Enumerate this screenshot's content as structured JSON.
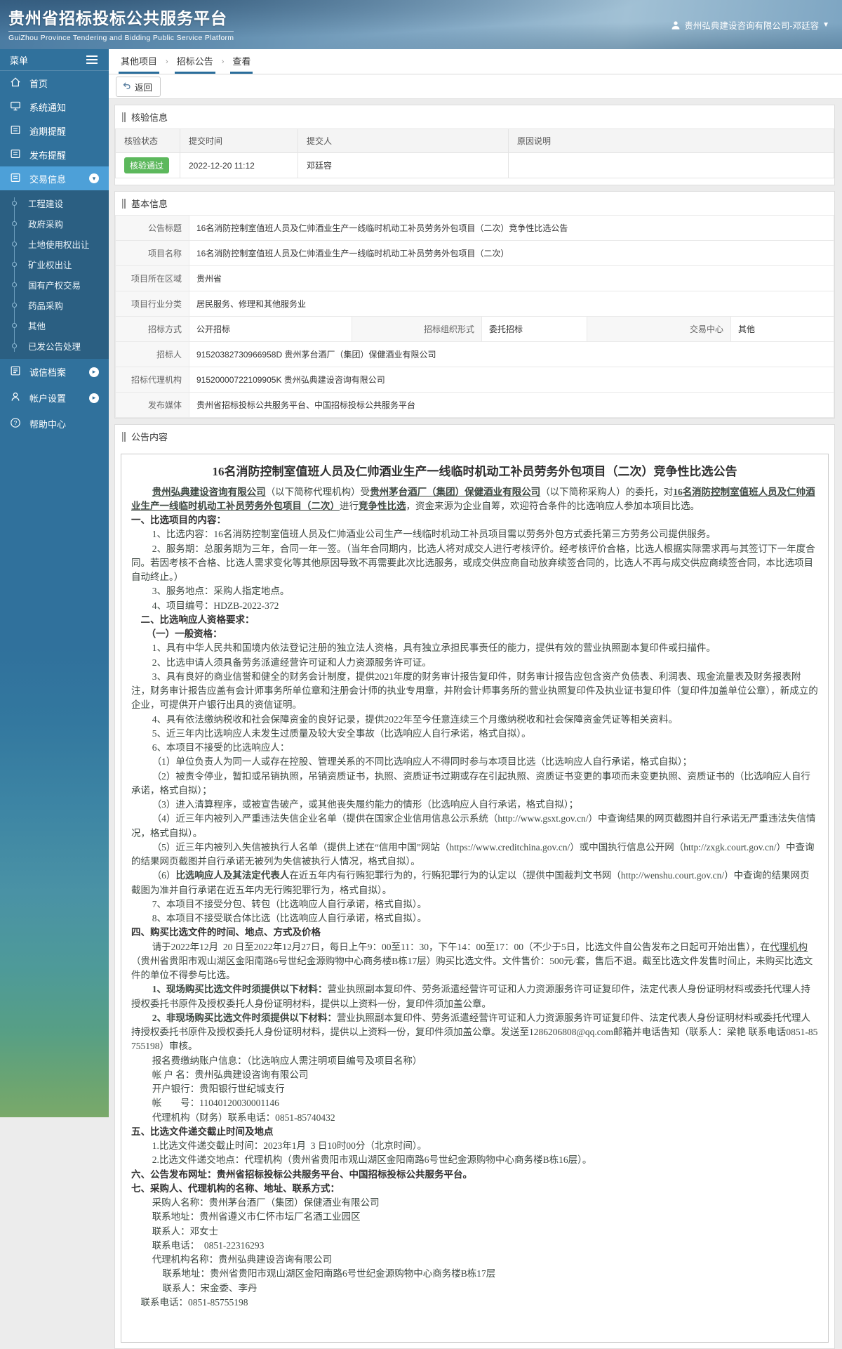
{
  "colors": {
    "accent": "#2a6d9b",
    "active_item": "#4da0d8",
    "badge_green": "#5cb85c",
    "sidebar": "#30719c",
    "submenu": "#2b5f82"
  },
  "header": {
    "title": "贵州省招标投标公共服务平台",
    "subtitle": "GuiZhou Province Tendering and Bidding Public Service Platform",
    "user": "贵州弘典建设咨询有限公司-邓廷容"
  },
  "sidebar": {
    "menu_label": "菜单",
    "items": [
      {
        "label": "首页"
      },
      {
        "label": "系统通知"
      },
      {
        "label": "逾期提醒"
      },
      {
        "label": "发布提醒"
      },
      {
        "label": "交易信息"
      }
    ],
    "submenu": [
      "工程建设",
      "政府采购",
      "土地使用权出让",
      "矿业权出让",
      "国有产权交易",
      "药品采购",
      "其他",
      "已发公告处理"
    ],
    "bottom_items": [
      "诚信档案",
      "帐户设置",
      "帮助中心"
    ]
  },
  "breadcrumb": [
    "其他项目",
    "招标公告",
    "查看"
  ],
  "toolbar": {
    "back_label": "返回"
  },
  "verify": {
    "section_title": "核验信息",
    "headers": [
      "核验状态",
      "提交时间",
      "提交人",
      "原因说明"
    ],
    "row": {
      "status": "核验通过",
      "time": "2022-12-20 11:12",
      "person": "邓廷容",
      "reason": ""
    }
  },
  "basic": {
    "section_title": "基本信息",
    "labels": {
      "title": "公告标题",
      "project": "项目名称",
      "region": "项目所在区域",
      "industry": "项目行业分类",
      "method": "招标方式",
      "org_form": "招标组织形式",
      "center": "交易中心",
      "tenderee": "招标人",
      "agency": "招标代理机构",
      "media": "发布媒体"
    },
    "values": {
      "title": "16名消防控制室值班人员及仁帅酒业生产一线临时机动工补员劳务外包项目（二次）竞争性比选公告",
      "project": "16名消防控制室值班人员及仁帅酒业生产一线临时机动工补员劳务外包项目（二次）",
      "region": "贵州省",
      "industry": "居民服务、修理和其他服务业",
      "method": "公开招标",
      "org_form": "委托招标",
      "center": "其他",
      "tenderee": "91520382730966958D 贵州茅台酒厂（集团）保健酒业有限公司",
      "agency": "91520000722109905K 贵州弘典建设咨询有限公司",
      "media": "贵州省招标投标公共服务平台、中国招标投标公共服务平台"
    }
  },
  "notice": {
    "section_title": "公告内容",
    "title": "16名消防控制室值班人员及仁帅酒业生产一线临时机动工补员劳务外包项目（二次）竞争性比选公告",
    "paragraphs": [
      {
        "cls": "i2",
        "runs": [
          {
            "t": "贵州弘典建设咨询有限公司",
            "b": 1,
            "u": 1
          },
          {
            "t": "（以下简称代理机构）受"
          },
          {
            "t": "贵州茅台酒厂（集团）保健酒业有限公司",
            "b": 1,
            "u": 1
          },
          {
            "t": "（以下简称采购人）的委托，对"
          },
          {
            "t": "16名消防控制室值班人员及仁帅酒业生产一线临时机动工补员劳务外包项目（二次）",
            "b": 1,
            "u": 1
          },
          {
            "t": "进行"
          },
          {
            "t": "竞争性比选",
            "b": 1,
            "u": 1
          },
          {
            "t": "，资金来源为企业自筹，欢迎符合条件的比选响应人参加本项目比选。"
          }
        ]
      },
      {
        "cls": "h",
        "t": "一、比选项目的内容："
      },
      {
        "cls": "i2",
        "t": "1、比选内容：16名消防控制室值班人员及仁帅酒业公司生产一线临时机动工补员项目需以劳务外包方式委托第三方劳务公司提供服务。"
      },
      {
        "cls": "i2",
        "t": "2、服务期：总服务期为三年，合同一年一签。（当年合同期内，比选人将对成交人进行考核评价。经考核评价合格，比选人根据实际需求再与其签订下一年度合同。若因考核不合格、比选人需求变化等其他原因导致不再需要此次比选服务，或成交供应商自动放弃续签合同的，比选人不再与成交供应商续签合同，本比选项目自动终止。）"
      },
      {
        "cls": "i2",
        "t": "3、服务地点：采购人指定地点。"
      },
      {
        "cls": "i2",
        "t": "4、项目编号：HDZB-2022-372"
      },
      {
        "cls": "h i1",
        "t": "二、比选响应人资格要求："
      },
      {
        "cls": "h i15",
        "t": "（一）一般资格："
      },
      {
        "cls": "i2",
        "t": "1、具有中华人民共和国境内依法登记注册的独立法人资格，具有独立承担民事责任的能力，提供有效的营业执照副本复印件或扫描件。"
      },
      {
        "cls": "i2",
        "t": "2、比选申请人须具备劳务派遣经营许可证和人力资源服务许可证。"
      },
      {
        "cls": "i2",
        "t": "3、具有良好的商业信誉和健全的财务会计制度，提供2021年度的财务审计报告复印件，财务审计报告应包含资产负债表、利润表、现金流量表及财务报表附注，财务审计报告应盖有会计师事务所单位章和注册会计师的执业专用章，并附会计师事务所的营业执照复印件及执业证书复印件（复印件加盖单位公章），新成立的企业，可提供开户银行出具的资信证明。"
      },
      {
        "cls": "i2",
        "t": "4、具有依法缴纳税收和社会保障资金的良好记录，提供2022年至今任意连续三个月缴纳税收和社会保障资金凭证等相关资料。"
      },
      {
        "cls": "i2",
        "t": "5、近三年内比选响应人未发生过质量及较大安全事故（比选响应人自行承诺，格式自拟）。"
      },
      {
        "cls": "i2",
        "t": "6、本项目不接受的比选响应人："
      },
      {
        "cls": "i2",
        "t": "（1）单位负责人为同一人或存在控股、管理关系的不同比选响应人不得同时参与本项目比选（比选响应人自行承诺，格式自拟）；"
      },
      {
        "cls": "i2",
        "t": "（2）被责令停业，暂扣或吊销执照，吊销资质证书，执照、资质证书过期或存在引起执照、资质证书变更的事项而未变更执照、资质证书的（比选响应人自行承诺，格式自拟）；"
      },
      {
        "cls": "i2",
        "t": "（3）进入清算程序，或被宣告破产，或其他丧失履约能力的情形（比选响应人自行承诺，格式自拟）；"
      },
      {
        "cls": "i2",
        "t": "（4）近三年内被列入严重违法失信企业名单（提供在国家企业信用信息公示系统（http://www.gsxt.gov.cn/）中查询结果的网页截图并自行承诺无严重违法失信情况，格式自拟）。"
      },
      {
        "cls": "i2",
        "t": "（5）近三年内被列入失信被执行人名单（提供上述在“信用中国”网站（https://www.creditchina.gov.cn/）或中国执行信息公开网（http://zxgk.court.gov.cn/）中查询的结果网页截图并自行承诺无被列为失信被执行人情况，格式自拟）。"
      },
      {
        "cls": "i2",
        "runs": [
          {
            "t": "（6）"
          },
          {
            "t": "比选响应人及其法定代表人",
            "b": 1
          },
          {
            "t": "在近五年内有行贿犯罪行为的，行贿犯罪行为的认定以（提供中国裁判文书网（http://wenshu.court.gov.cn/）中查询的结果网页截图为准并自行承诺在近五年内无行贿犯罪行为，格式自拟）。"
          }
        ]
      },
      {
        "cls": "i2",
        "t": "7、本项目不接受分包、转包（比选响应人自行承诺，格式自拟）。"
      },
      {
        "cls": "i2",
        "t": "8、本项目不接受联合体比选（比选响应人自行承诺，格式自拟）。"
      },
      {
        "cls": "h",
        "t": "四、购买比选文件的时间、地点、方式及价格"
      },
      {
        "cls": "i2",
        "runs": [
          {
            "t": "请于2022年12月  20 日至2022年12月27日，每日上午9：00至11：30，下午14：00至17：00（不少于5日，比选文件自公告发布之日起可开始出售），在"
          },
          {
            "t": "代理机构",
            "u": 1
          },
          {
            "t": "（贵州省贵阳市观山湖区金阳南路6号世纪金源购物中心商务楼B栋17层）购买比选文件。文件售价：500元/套，售后不退。截至比选文件发售时间止，未购买比选文件的单位不得参与比选。"
          }
        ]
      },
      {
        "cls": "i2",
        "runs": [
          {
            "t": "1、现场购买比选文件时须提供以下材料：",
            "b": 1
          },
          {
            "t": "营业执照副本复印件、劳务派遣经营许可证和人力资源服务许可证复印件，法定代表人身份证明材料或委托代理人持授权委托书原件及授权委托人身份证明材料，提供以上资料一份，复印件须加盖公章。"
          }
        ]
      },
      {
        "cls": "i2",
        "runs": [
          {
            "t": "2、非现场购买比选文件时须提供以下材料：",
            "b": 1
          },
          {
            "t": "营业执照副本复印件、劳务派遣经营许可证和人力资源服务许可证复印件、法定代表人身份证明材料或委托代理人持授权委托书原件及授权委托人身份证明材料，提供以上资料一份，复印件须加盖公章。发送至1286206808@qq.com邮箱并电话告知（联系人：梁艳 联系电话0851-85755198）审核。"
          }
        ]
      },
      {
        "cls": "i2",
        "t": "报名费缴纳账户信息：（比选响应人需注明项目编号及项目名称）"
      },
      {
        "cls": "i2",
        "t": "帐 户 名：贵州弘典建设咨询有限公司"
      },
      {
        "cls": "i2",
        "t": "开户银行：贵阳银行世纪城支行"
      },
      {
        "cls": "i2",
        "t": "帐        号：11040120030001146"
      },
      {
        "cls": "i2",
        "t": "代理机构（财务）联系电话：0851-85740432"
      },
      {
        "cls": "h",
        "t": "五、比选文件递交截止时间及地点"
      },
      {
        "cls": "i2",
        "t": "1.比选文件递交截止时间：2023年1月  3 日10时00分（北京时间）。"
      },
      {
        "cls": "i2",
        "t": "2.比选文件递交地点：代理机构（贵州省贵阳市观山湖区金阳南路6号世纪金源购物中心商务楼B栋16层）。"
      },
      {
        "cls": "h",
        "runs": [
          {
            "t": "六、公告发布网址：",
            "b": 1
          },
          {
            "t": "贵州省招标投标公共服务平台、中国招标投标公共服务平台。"
          }
        ]
      },
      {
        "cls": "h",
        "t": "七、采购人、代理机构的名称、地址、联系方式："
      },
      {
        "cls": "i2",
        "t": "采购人名称：贵州茅台酒厂（集团）保健酒业有限公司"
      },
      {
        "cls": "i2",
        "t": "联系地址：贵州省遵义市仁怀市坛厂名酒工业园区"
      },
      {
        "cls": "i2",
        "t": "联系人：邓女士"
      },
      {
        "cls": "i2",
        "t": "联系电话：  0851-22316293"
      },
      {
        "cls": "i2",
        "t": "代理机构名称：贵州弘典建设咨询有限公司"
      },
      {
        "cls": "i3",
        "t": "联系地址：贵州省贵阳市观山湖区金阳南路6号世纪金源购物中心商务楼B栋17层"
      },
      {
        "cls": "i3",
        "t": "联系人：宋金委、李丹"
      },
      {
        "cls": "i1",
        "t": "联系电话：0851-85755198"
      }
    ]
  }
}
